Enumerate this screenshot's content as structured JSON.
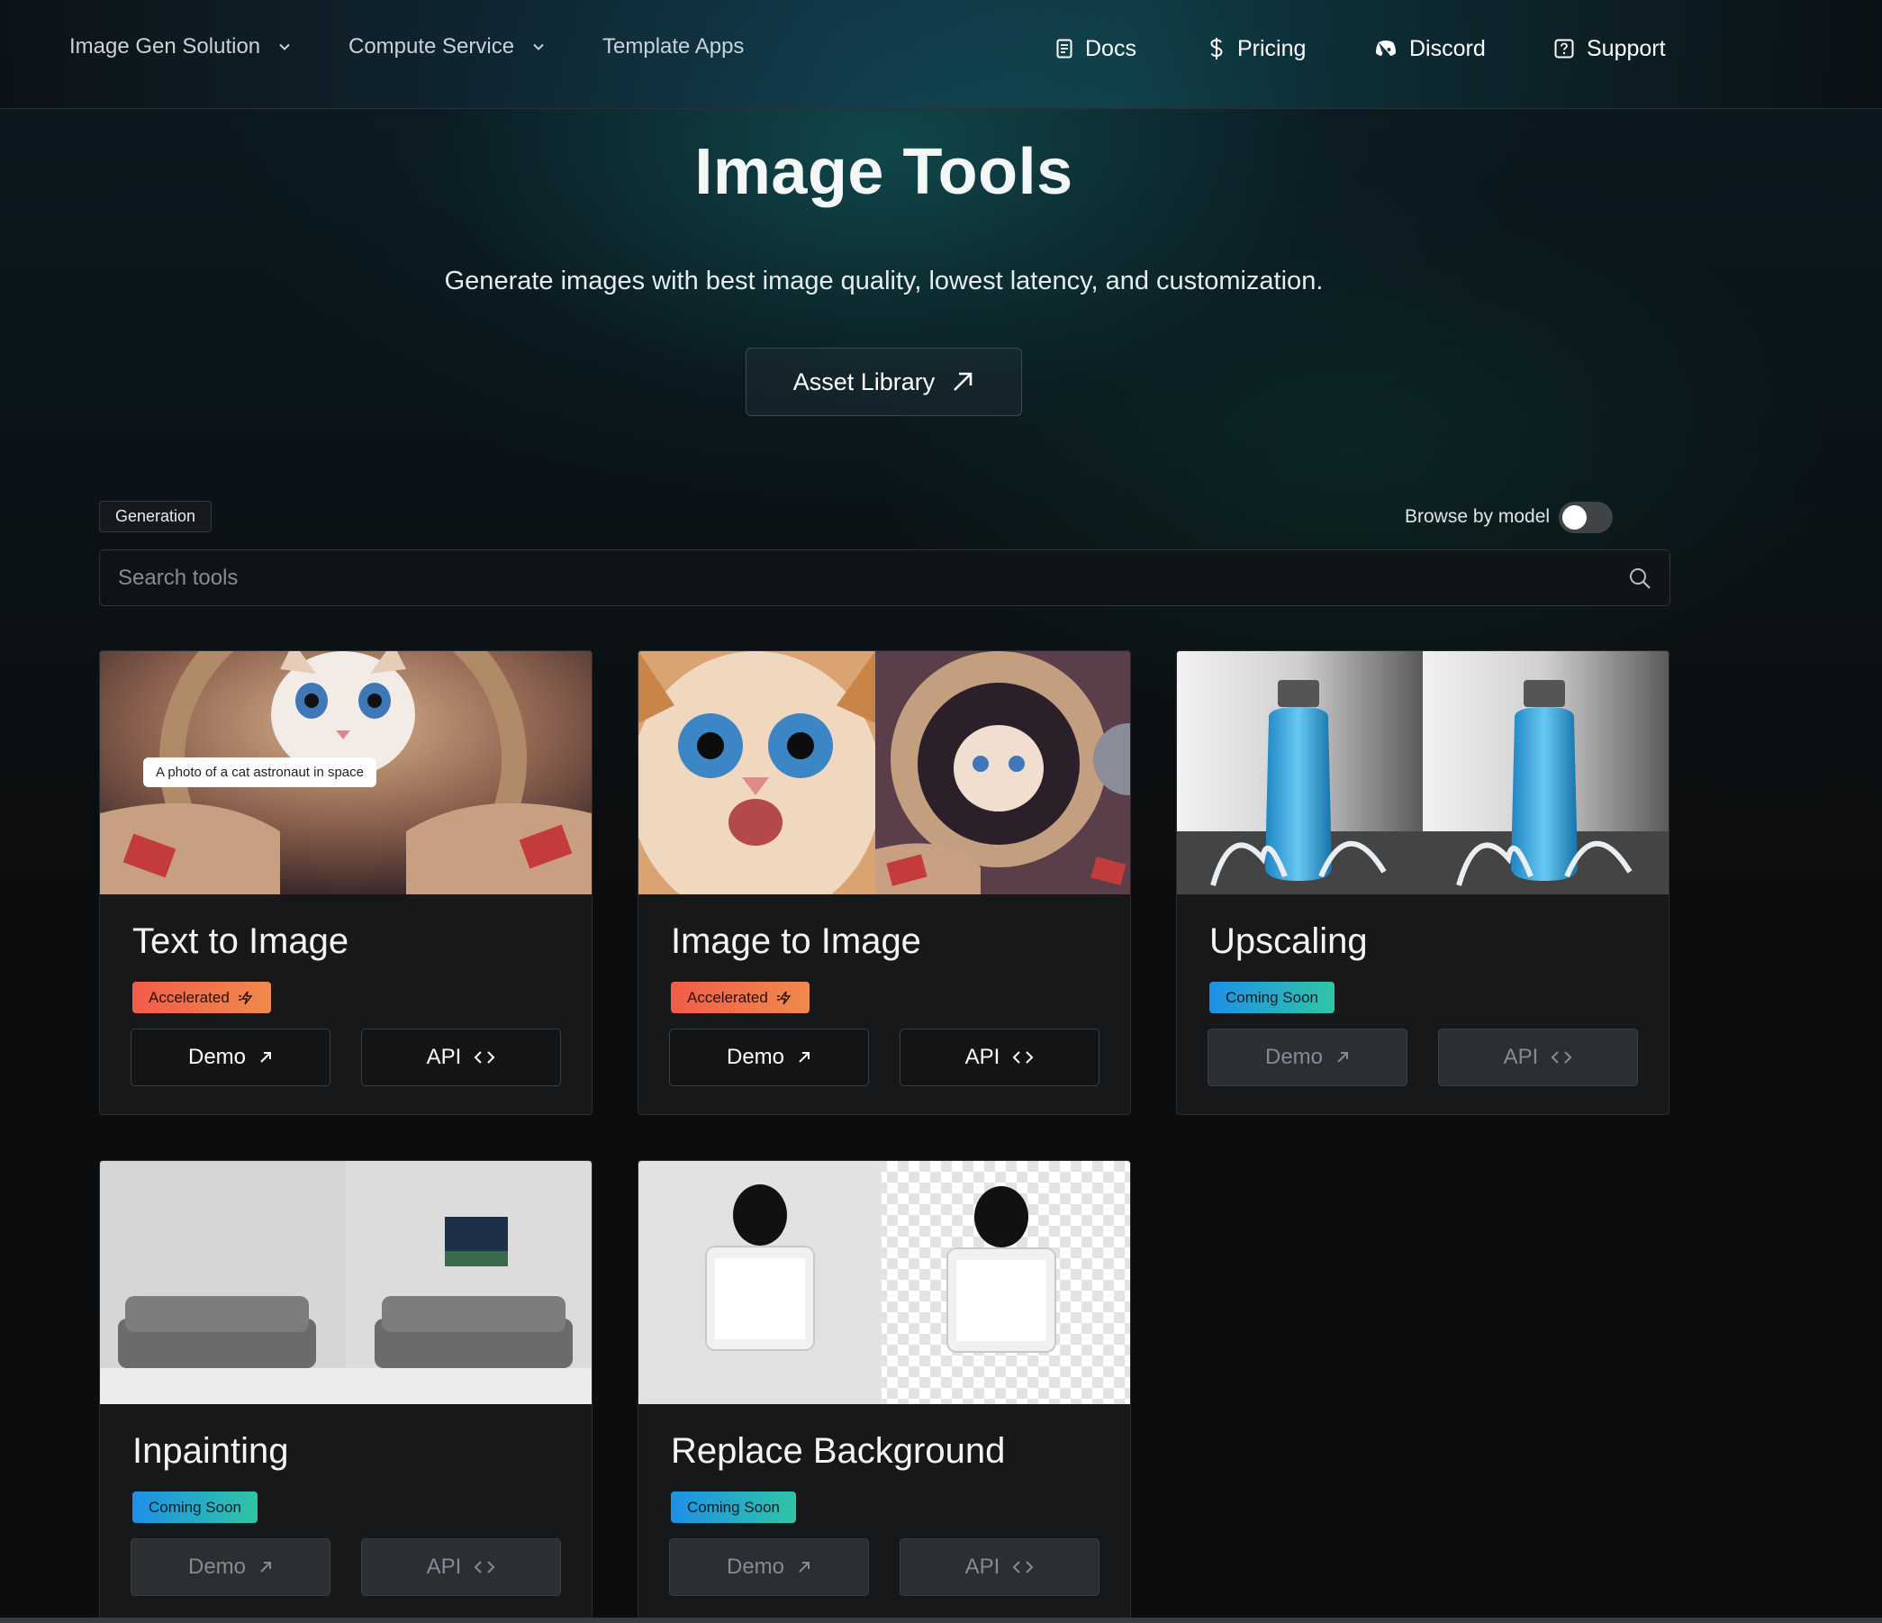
{
  "nav": {
    "left": [
      {
        "label": "Image Gen Solution",
        "dropdown": true
      },
      {
        "label": "Compute Service",
        "dropdown": true
      },
      {
        "label": "Template Apps",
        "dropdown": false
      }
    ],
    "right": [
      {
        "label": "Docs",
        "icon": "doc-icon"
      },
      {
        "label": "Pricing",
        "icon": "dollar-icon"
      },
      {
        "label": "Discord",
        "icon": "discord-icon"
      },
      {
        "label": "Support",
        "icon": "question-icon"
      }
    ]
  },
  "hero": {
    "title": "Image Tools",
    "subtitle": "Generate images with best image quality, lowest latency, and customization.",
    "asset_button": "Asset Library"
  },
  "filters": {
    "category_tag": "Generation",
    "browse_by_model_label": "Browse by model",
    "browse_by_model_on": false
  },
  "search": {
    "placeholder": "Search tools",
    "value": ""
  },
  "cards": [
    {
      "title": "Text to Image",
      "badge": "Accelerated",
      "badge_type": "accelerated",
      "demo": "Demo",
      "api": "API",
      "enabled": true,
      "prompt_bubble": "A photo of a cat astronaut in space"
    },
    {
      "title": "Image to Image",
      "badge": "Accelerated",
      "badge_type": "accelerated",
      "demo": "Demo",
      "api": "API",
      "enabled": true
    },
    {
      "title": "Upscaling",
      "badge": "Coming Soon",
      "badge_type": "coming-soon",
      "demo": "Demo",
      "api": "API",
      "enabled": false
    },
    {
      "title": "Inpainting",
      "badge": "Coming Soon",
      "badge_type": "coming-soon",
      "demo": "Demo",
      "api": "API",
      "enabled": false
    },
    {
      "title": "Replace Background",
      "badge": "Coming Soon",
      "badge_type": "coming-soon",
      "demo": "Demo",
      "api": "API",
      "enabled": false
    }
  ],
  "colors": {
    "accelerated_badge": "#f25c4a",
    "coming_soon_badge": "#1e90e8",
    "background": "#0b0c0d"
  }
}
